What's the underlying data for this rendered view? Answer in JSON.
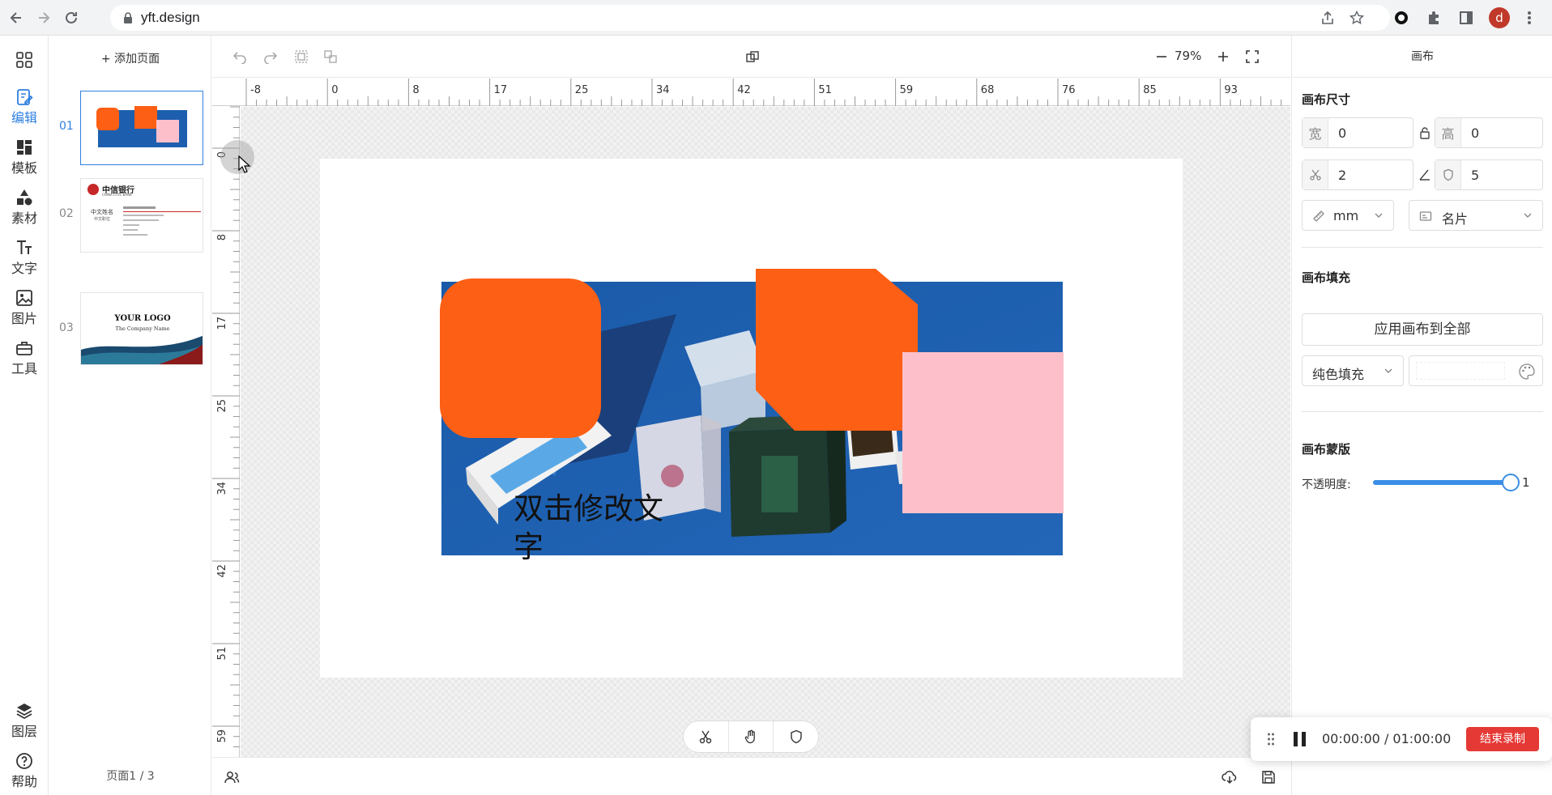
{
  "browser": {
    "url": "yft.design",
    "profile_initial": "d"
  },
  "rail": {
    "items": [
      {
        "label": "编辑",
        "icon": "edit-icon",
        "active": true
      },
      {
        "label": "模板",
        "icon": "template-icon"
      },
      {
        "label": "素材",
        "icon": "shapes-icon"
      },
      {
        "label": "文字",
        "icon": "text-icon"
      },
      {
        "label": "图片",
        "icon": "image-icon"
      },
      {
        "label": "工具",
        "icon": "toolbox-icon"
      }
    ],
    "bottom": [
      {
        "label": "图层",
        "icon": "layers-icon"
      },
      {
        "label": "帮助",
        "icon": "help-icon"
      }
    ]
  },
  "pages": {
    "add_label": "添加页面",
    "items": [
      {
        "num": "01",
        "active": true
      },
      {
        "num": "02",
        "bank_name": "中信银行",
        "bank_en": "CHINA CITIC BANK",
        "name_cn": "中文姓名",
        "title_cn": "中文职位"
      },
      {
        "num": "03",
        "logo": "YOUR LOGO",
        "company": "The Company Name"
      }
    ],
    "indicator": "页面1 / 3"
  },
  "toolbar": {
    "zoom": "79%"
  },
  "ruler": {
    "unit": "mm",
    "h_labels": [
      "-8",
      "0",
      "8",
      "17",
      "25",
      "34",
      "42",
      "51",
      "59",
      "68",
      "76",
      "85",
      "93"
    ],
    "v_labels": [
      "0",
      "8",
      "17",
      "25",
      "34",
      "42",
      "51",
      "59"
    ]
  },
  "canvas": {
    "text": "双击修改文字",
    "colors": {
      "orange": "#fd5f15",
      "pink": "#fdc0cb",
      "photo_bg": "#1d5fae"
    }
  },
  "right_panel": {
    "title": "画布",
    "size_heading": "画布尺寸",
    "width_label": "宽",
    "width_value": "0",
    "height_label": "高",
    "height_value": "0",
    "bleed_value": "2",
    "radius_value": "5",
    "unit_select": "mm",
    "preset_select": "名片",
    "fill_heading": "画布填充",
    "apply_all": "应用画布到全部",
    "fill_type": "纯色填充",
    "mask_heading": "画布蒙版",
    "opacity_label": "不透明度:",
    "opacity_value": "1",
    "opacity_fraction": 1.0
  },
  "recorder": {
    "time": "00:00:00 / 01:00:00",
    "stop_label": "结束录制"
  }
}
